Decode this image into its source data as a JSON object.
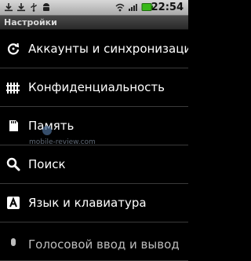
{
  "status_bar": {
    "time": "22:54",
    "icons": [
      "download-icon",
      "download-icon",
      "usb-icon",
      "android-icon",
      "wifi-icon",
      "signal-icon",
      "battery-icon"
    ]
  },
  "title_bar": {
    "title": "Настройки"
  },
  "menu": {
    "items": [
      {
        "label": "Аккаунты и синхронизация",
        "icon": "sync-icon"
      },
      {
        "label": "Конфиденциальность",
        "icon": "privacy-icon"
      },
      {
        "label": "Память",
        "icon": "sd-card-icon"
      },
      {
        "label": "Поиск",
        "icon": "search-icon"
      },
      {
        "label": "Язык и клавиатура",
        "icon": "keyboard-icon"
      },
      {
        "label": "Голосовой ввод и вывод",
        "icon": "voice-icon"
      }
    ]
  },
  "watermark": {
    "text": "mobile-review.com"
  }
}
